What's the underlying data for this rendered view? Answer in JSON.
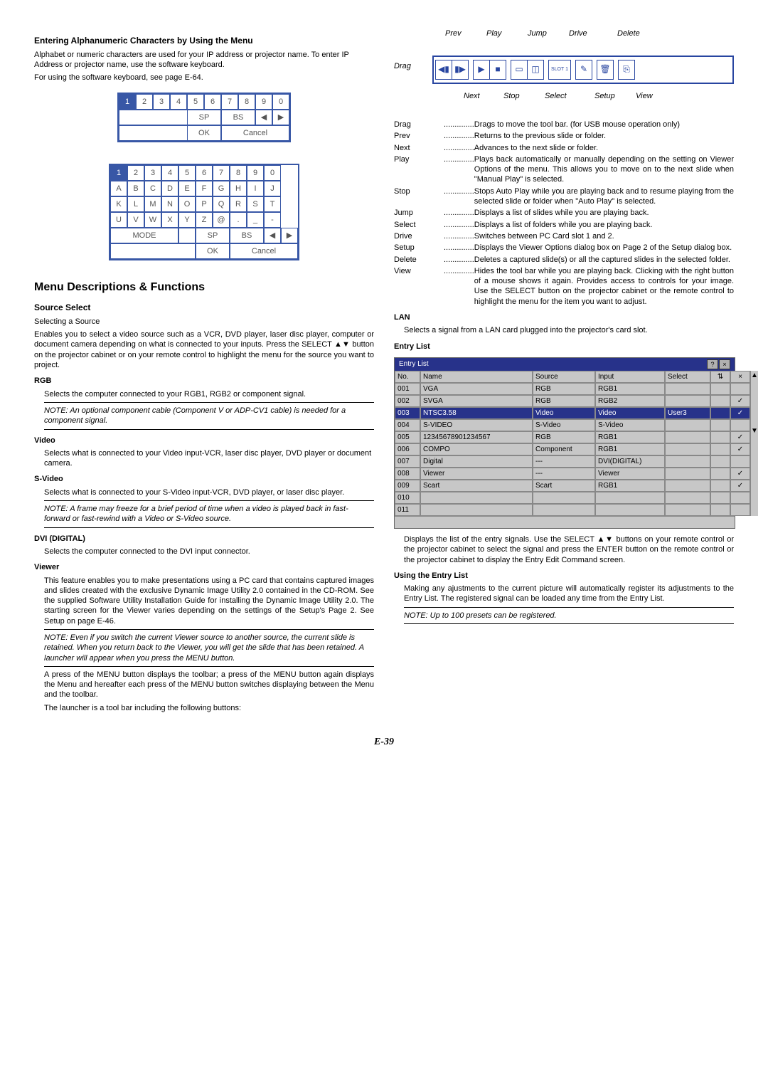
{
  "left": {
    "heading1": "Entering Alphanumeric Characters by Using the Menu",
    "p1": "Alphabet or numeric characters are used for your IP address or projector name. To enter IP Address or projector name, use the software keyboard.",
    "p2": "For using the software keyboard, see page E-64.",
    "kb1": {
      "r1": [
        "1",
        "2",
        "3",
        "4",
        "5",
        "6",
        "7",
        "8",
        "9",
        "0"
      ],
      "r2_sp": "SP",
      "r2_bs": "BS",
      "r2_l": "◀",
      "r2_r": "▶",
      "r3_ok": "OK",
      "r3_cancel": "Cancel"
    },
    "kb2": {
      "r1": [
        "1",
        "2",
        "3",
        "4",
        "5",
        "6",
        "7",
        "8",
        "9",
        "0"
      ],
      "r2": [
        "A",
        "B",
        "C",
        "D",
        "E",
        "F",
        "G",
        "H",
        "I",
        "J"
      ],
      "r3": [
        "K",
        "L",
        "M",
        "N",
        "O",
        "P",
        "Q",
        "R",
        "S",
        "T"
      ],
      "r4": [
        "U",
        "V",
        "W",
        "X",
        "Y",
        "Z",
        "@",
        ".",
        "_",
        "-"
      ],
      "mode": "MODE",
      "sp": "SP",
      "bs": "BS",
      "l": "◀",
      "r": "▶",
      "ok": "OK",
      "cancel": "Cancel"
    },
    "h2": "Menu Descriptions & Functions",
    "h3_source": "Source Select",
    "src_p1": "Selecting a Source",
    "src_p2": "Enables you to select a video source such as a VCR, DVD player, laser disc player, computer or document camera depending on what is connected to your inputs. Press the SELECT ▲▼ button on the projector cabinet or on your remote control to highlight the menu for the source you want to project.",
    "rgb_h": "RGB",
    "rgb_p": "Selects the computer connected to your RGB1, RGB2 or component signal.",
    "rgb_note": "NOTE: An optional component cable (Component V or ADP-CV1 cable) is needed for a component signal.",
    "video_h": "Video",
    "video_p": "Selects what is connected to your Video input-VCR, laser disc player, DVD player or document camera.",
    "svideo_h": "S-Video",
    "svideo_p": "Selects what is connected to your S-Video input-VCR, DVD player, or laser disc player.",
    "svideo_note": "NOTE: A frame may freeze for a brief period of time when a video is played back in fast-forward or fast-rewind with a Video or S-Video source.",
    "dvi_h": "DVI (DIGITAL)",
    "dvi_p": "Selects the computer connected to the DVI input connector.",
    "viewer_h": "Viewer",
    "viewer_p": "This feature enables you to make presentations using a PC card that contains captured images and slides created with the exclusive Dynamic Image Utility 2.0 contained in the CD-ROM. See the supplied Software Utility Installation Guide for installing the Dynamic Image Utility 2.0. The starting screen for the Viewer varies depending on the settings of the Setup's Page 2. See Setup on page E-46.",
    "viewer_note": "NOTE: Even if you switch the current Viewer source to another source, the current slide is retained. When you return back to the Viewer, you will get the slide that has been retained. A launcher will appear when you press the MENU button.",
    "viewer_p2": "A press of the MENU button displays the toolbar; a press of the MENU button again displays the Menu and hereafter each press of the MENU button switches displaying between the Menu and the toolbar.",
    "viewer_p3": "The launcher is a tool bar including the following buttons:"
  },
  "right": {
    "tbar_labels_top": [
      "Prev",
      "Play",
      "Jump",
      "Drive",
      "Delete"
    ],
    "tbar_drag": "Drag",
    "tbar_labels_bot": [
      "Next",
      "Stop",
      "Select",
      "Setup",
      "View"
    ],
    "slot": "SLOT 1",
    "defs": [
      {
        "t": "Drag",
        "d": "Drags to move the tool bar. (for USB mouse operation only)"
      },
      {
        "t": "Prev",
        "d": "Returns to the previous slide or folder."
      },
      {
        "t": "Next",
        "d": "Advances to the next slide or folder."
      },
      {
        "t": "Play",
        "d": "Plays back automatically or manually depending on the setting on Viewer Options of the menu. This allows you to move on to the next slide when \"Manual Play\" is selected."
      },
      {
        "t": "Stop",
        "d": "Stops Auto Play while you are playing back and to resume playing from the selected slide or folder when \"Auto Play\" is selected."
      },
      {
        "t": "Jump",
        "d": "Displays a list of slides while you are playing back."
      },
      {
        "t": "Select",
        "d": "Displays a list of folders while you are playing back."
      },
      {
        "t": "Drive",
        "d": "Switches between PC Card slot 1 and 2."
      },
      {
        "t": "Setup",
        "d": "Displays the Viewer Options dialog box on Page 2 of the Setup dialog box."
      },
      {
        "t": "Delete",
        "d": "Deletes a captured slide(s) or all the captured slides in the selected folder."
      },
      {
        "t": "View",
        "d": "Hides the tool bar while you are playing back. Clicking with the right button of a mouse shows it again. Provides access to controls for your image. Use the SELECT button on the projector cabinet or the remote control to highlight the menu for the item you want to adjust."
      }
    ],
    "lan_h": "LAN",
    "lan_p": "Selects a signal from a LAN card plugged into the projector's card slot.",
    "el_h": "Entry List",
    "el_title": "Entry List",
    "el_head": [
      "No.",
      "Name",
      "Source",
      "Input",
      "Select"
    ],
    "el_rows": [
      {
        "no": "001",
        "name": "VGA",
        "src": "RGB",
        "inp": "RGB1",
        "sel": "",
        "chk": ""
      },
      {
        "no": "002",
        "name": "SVGA",
        "src": "RGB",
        "inp": "RGB2",
        "sel": "",
        "chk": "✓"
      },
      {
        "no": "003",
        "name": "NTSC3.58",
        "src": "Video",
        "inp": "Video",
        "sel": "User3",
        "chk": "✓",
        "hl": true
      },
      {
        "no": "004",
        "name": "S-VIDEO",
        "src": "S-Video",
        "inp": "S-Video",
        "sel": "",
        "chk": ""
      },
      {
        "no": "005",
        "name": "12345678901234567",
        "src": "RGB",
        "inp": "RGB1",
        "sel": "",
        "chk": "✓"
      },
      {
        "no": "006",
        "name": "COMPO",
        "src": "Component",
        "inp": "RGB1",
        "sel": "",
        "chk": "✓"
      },
      {
        "no": "007",
        "name": "Digital",
        "src": "---",
        "inp": "DVI(DIGITAL)",
        "sel": "",
        "chk": ""
      },
      {
        "no": "008",
        "name": "Viewer",
        "src": "---",
        "inp": "Viewer",
        "sel": "",
        "chk": "✓"
      },
      {
        "no": "009",
        "name": "Scart",
        "src": "Scart",
        "inp": "RGB1",
        "sel": "",
        "chk": "✓"
      },
      {
        "no": "010",
        "name": "",
        "src": "",
        "inp": "",
        "sel": "",
        "chk": ""
      },
      {
        "no": "011",
        "name": "",
        "src": "",
        "inp": "",
        "sel": "",
        "chk": ""
      }
    ],
    "el_p": "Displays the list of the entry signals. Use the SELECT ▲▼ buttons on your remote control or the projector cabinet to select the signal and press the ENTER button on the remote control or the projector cabinet to display the Entry Edit Command screen.",
    "using_h": "Using the Entry List",
    "using_p": "Making any ajustments to the current picture will automatically register its adjustments to the Entry List. The registered signal can be loaded any time from the Entry List.",
    "using_note": "NOTE: Up to 100 presets can be registered."
  },
  "page": "E-39"
}
